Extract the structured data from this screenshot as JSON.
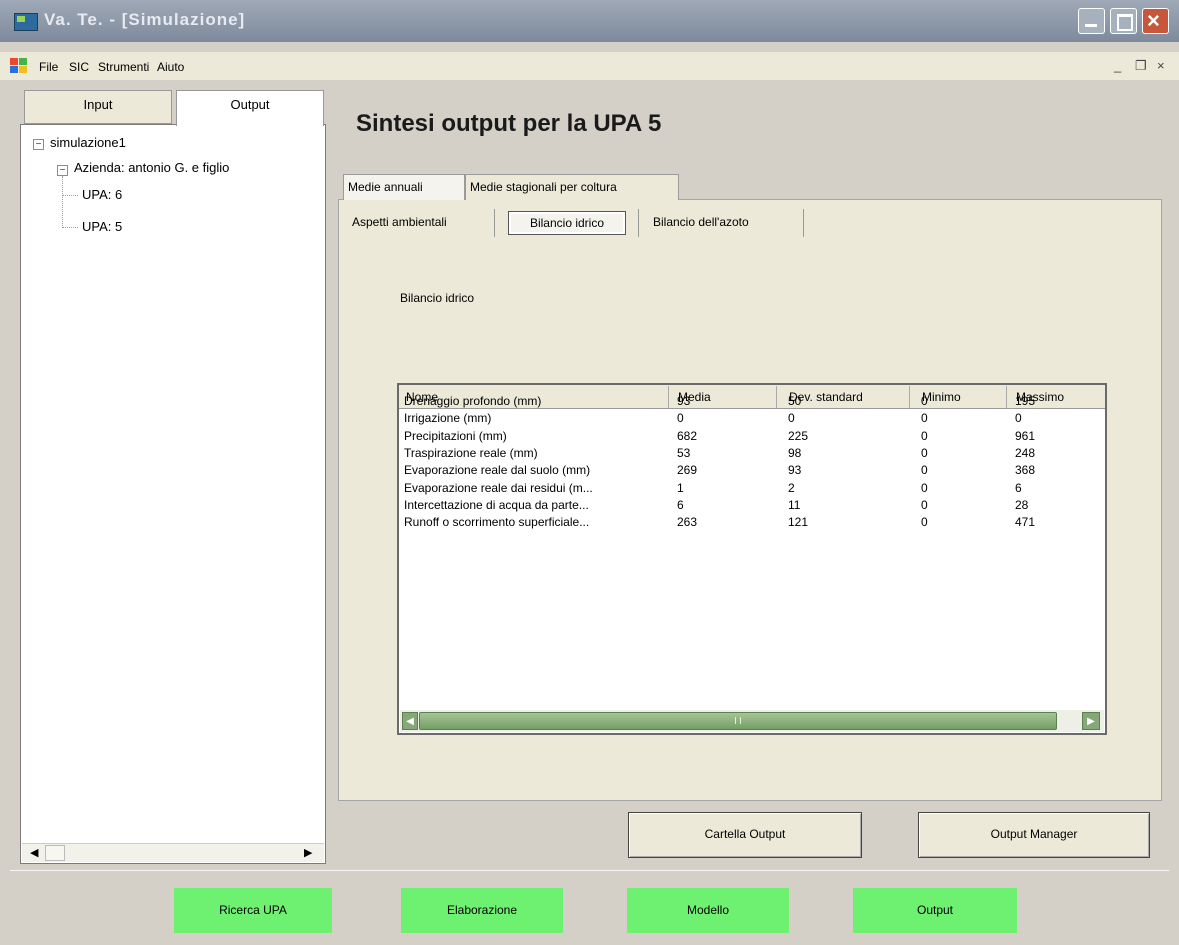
{
  "window": {
    "title": "Va. Te. - [Simulazione]"
  },
  "menu": {
    "items": [
      "File",
      "SIC",
      "Strumenti",
      "Aiuto"
    ]
  },
  "left_panel": {
    "tabs": {
      "input": "Input",
      "output": "Output"
    },
    "tree": {
      "root": "simulazione1",
      "azienda": "Azienda: antonio G. e figlio",
      "upa": [
        "UPA: 6",
        "UPA: 5"
      ]
    }
  },
  "main": {
    "title": "Sintesi output per la UPA 5",
    "tabs": [
      "Medie annuali",
      "Medie stagionali per coltura"
    ],
    "subtabs": [
      "Aspetti ambientali",
      "Bilancio idrico",
      "Bilancio dell'azoto"
    ],
    "section_label": "Bilancio idrico",
    "table": {
      "columns": [
        "Nome",
        "Media",
        "Dev. standard",
        "Minimo",
        "Massimo"
      ],
      "rows": [
        [
          "Drenaggio profondo (mm)",
          "93",
          "50",
          "0",
          "195"
        ],
        [
          "Irrigazione (mm)",
          "0",
          "0",
          "0",
          "0"
        ],
        [
          "Precipitazioni (mm)",
          "682",
          "225",
          "0",
          "961"
        ],
        [
          "Traspirazione reale (mm)",
          "53",
          "98",
          "0",
          "248"
        ],
        [
          "Evaporazione reale dal suolo (mm)",
          "269",
          "93",
          "0",
          "368"
        ],
        [
          "Evaporazione reale dai residui (m...",
          "1",
          "2",
          "0",
          "6"
        ],
        [
          "Intercettazione di acqua da parte...",
          "6",
          "11",
          "0",
          "28"
        ],
        [
          "Runoff o scorrimento superficiale...",
          "263",
          "121",
          "0",
          "471"
        ]
      ]
    },
    "buttons": {
      "cartella": "Cartella Output",
      "output_manager": "Output Manager"
    }
  },
  "bottom_nav": [
    "Ricerca UPA",
    "Elaborazione",
    "Modello",
    "Output"
  ],
  "colors": {
    "green_button": "#6ef070",
    "close_button": "#c8563b"
  }
}
